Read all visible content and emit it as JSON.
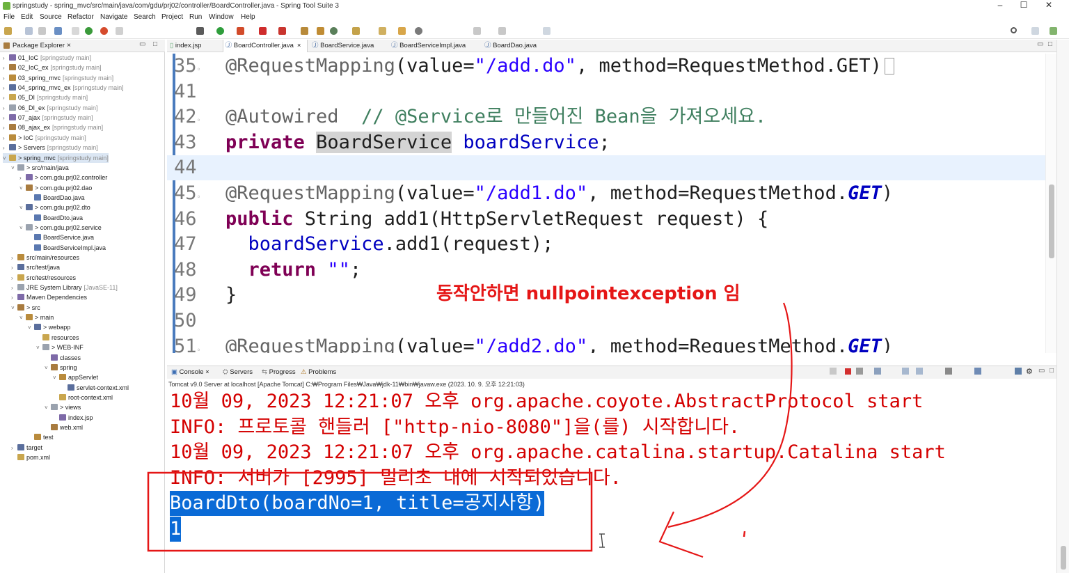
{
  "window": {
    "title": "springstudy - spring_mvc/src/main/java/com/gdu/prj02/controller/BoardController.java - Spring Tool Suite 3",
    "controls": [
      "–",
      "☐",
      "✕"
    ]
  },
  "menu": [
    "File",
    "Edit",
    "Source",
    "Refactor",
    "Navigate",
    "Search",
    "Project",
    "Run",
    "Window",
    "Help"
  ],
  "package_explorer": {
    "tab_label": "Package Explorer",
    "items": [
      {
        "name": "01_IoC",
        "deco": "[springstudy main]"
      },
      {
        "name": "02_IoC_ex",
        "deco": "[springstudy main]"
      },
      {
        "name": "03_spring_mvc",
        "deco": "[springstudy main]"
      },
      {
        "name": "04_spring_mvc_ex",
        "deco": "[springstudy main]"
      },
      {
        "name": "05_DI",
        "deco": "[springstudy main]"
      },
      {
        "name": "06_DI_ex",
        "deco": "[springstudy main]"
      },
      {
        "name": "07_ajax",
        "deco": "[springstudy main]"
      },
      {
        "name": "08_ajax_ex",
        "deco": "[springstudy main]"
      },
      {
        "name": "> IoC",
        "deco": "[springstudy main]"
      },
      {
        "name": "> Servers",
        "deco": "[springstudy main]"
      },
      {
        "name": "> spring_mvc",
        "deco": "[springstudy main]"
      },
      {
        "name": "> src/main/java",
        "deco": ""
      },
      {
        "name": "> com.gdu.prj02.controller",
        "deco": ""
      },
      {
        "name": "> com.gdu.prj02.dao",
        "deco": ""
      },
      {
        "name": "BoardDao.java",
        "deco": ""
      },
      {
        "name": "> com.gdu.prj02.dto",
        "deco": ""
      },
      {
        "name": "BoardDto.java",
        "deco": ""
      },
      {
        "name": "> com.gdu.prj02.service",
        "deco": ""
      },
      {
        "name": "BoardService.java",
        "deco": ""
      },
      {
        "name": "BoardServiceImpl.java",
        "deco": ""
      },
      {
        "name": "src/main/resources",
        "deco": ""
      },
      {
        "name": "src/test/java",
        "deco": ""
      },
      {
        "name": "src/test/resources",
        "deco": ""
      },
      {
        "name": "JRE System Library",
        "deco": "[JavaSE-11]"
      },
      {
        "name": "Maven Dependencies",
        "deco": ""
      },
      {
        "name": "> src",
        "deco": ""
      },
      {
        "name": "> main",
        "deco": ""
      },
      {
        "name": "> webapp",
        "deco": ""
      },
      {
        "name": "resources",
        "deco": ""
      },
      {
        "name": "> WEB-INF",
        "deco": ""
      },
      {
        "name": "classes",
        "deco": ""
      },
      {
        "name": "spring",
        "deco": ""
      },
      {
        "name": "appServlet",
        "deco": ""
      },
      {
        "name": "servlet-context.xml",
        "deco": ""
      },
      {
        "name": "root-context.xml",
        "deco": ""
      },
      {
        "name": "> views",
        "deco": ""
      },
      {
        "name": "index.jsp",
        "deco": ""
      },
      {
        "name": "web.xml",
        "deco": ""
      },
      {
        "name": "test",
        "deco": ""
      },
      {
        "name": "target",
        "deco": ""
      },
      {
        "name": "pom.xml",
        "deco": ""
      }
    ]
  },
  "editor": {
    "tabs": [
      "index.jsp",
      "BoardController.java",
      "BoardService.java",
      "BoardServiceImpl.java",
      "BoardDao.java"
    ],
    "lines": [
      {
        "num": "35",
        "fold": "◦",
        "parts": [
          [
            "ann",
            "@RequestMapping"
          ],
          [
            "",
            "(value="
          ],
          [
            "str",
            "\"/add.do\""
          ],
          [
            "",
            ", method=RequestMethod.GET)"
          ]
        ]
      },
      {
        "num": "41",
        "fold": "",
        "parts": []
      },
      {
        "num": "42",
        "fold": "◦",
        "parts": [
          [
            "ann",
            "@Autowired"
          ],
          [
            "",
            "  "
          ],
          [
            "cm",
            "// @Service로 만들어진 Bean을 가져오세요."
          ]
        ]
      },
      {
        "num": "43",
        "fold": "",
        "parts": [
          [
            "kw",
            "private"
          ],
          [
            "",
            " "
          ],
          [
            "hl",
            "BoardService"
          ],
          [
            "",
            " "
          ],
          [
            "fld",
            "boardService"
          ],
          [
            "",
            ";"
          ]
        ]
      },
      {
        "num": "44",
        "fold": "",
        "parts": []
      },
      {
        "num": "45",
        "fold": "◦",
        "parts": [
          [
            "ann",
            "@RequestMapping"
          ],
          [
            "",
            "(value="
          ],
          [
            "str",
            "\"/add1.do\""
          ],
          [
            "",
            ", method=RequestMethod."
          ],
          [
            "it",
            "GET"
          ],
          [
            "",
            ")"
          ]
        ]
      },
      {
        "num": "46",
        "fold": "",
        "parts": [
          [
            "kw",
            "public"
          ],
          [
            "",
            " String add1(HttpServletRequest request) {"
          ]
        ]
      },
      {
        "num": "47",
        "fold": "",
        "parts": [
          [
            "",
            "  "
          ],
          [
            "fld",
            "boardService"
          ],
          [
            "",
            ".add1(request);"
          ]
        ]
      },
      {
        "num": "48",
        "fold": "",
        "parts": [
          [
            "",
            "  "
          ],
          [
            "kw",
            "return"
          ],
          [
            "",
            " "
          ],
          [
            "str",
            "\"\""
          ],
          [
            "",
            ";"
          ]
        ]
      },
      {
        "num": "49",
        "fold": "",
        "parts": [
          [
            "",
            "}"
          ]
        ]
      },
      {
        "num": "50",
        "fold": "",
        "parts": []
      },
      {
        "num": "51",
        "fold": "◦",
        "parts": [
          [
            "ann",
            "@RequestMapping"
          ],
          [
            "",
            "(value="
          ],
          [
            "str",
            "\"/add2.do\""
          ],
          [
            "",
            ", method=RequestMethod."
          ],
          [
            "it",
            "GET"
          ],
          [
            "",
            ")"
          ]
        ]
      }
    ]
  },
  "annotation_note": "동작안하면 nullpointexception 임",
  "console": {
    "tabs": [
      "Console",
      "Servers",
      "Progress",
      "Problems"
    ],
    "description": "Tomcat v9.0 Server at localhost [Apache Tomcat] C:₩Program Files₩Java₩jdk-11₩bin₩javaw.exe  (2023. 10. 9. 오후 12:21:03)",
    "lines": [
      "10월 09, 2023 12:21:07 오후 org.apache.coyote.AbstractProtocol start",
      "INFO: 프로토콜 핸들러 [\"http-nio-8080\"]을(를) 시작합니다.",
      "10월 09, 2023 12:21:07 오후 org.apache.catalina.startup.Catalina start",
      "INFO: 서버가 [2995] 밀리초 내에 시작되었습니다.",
      "BoardDto(boardNo=1, title=공지사항)",
      "1"
    ]
  },
  "colors": {
    "accent": "#0a6ad6",
    "annotation_red": "#e51616",
    "console_red": "#d40000"
  }
}
